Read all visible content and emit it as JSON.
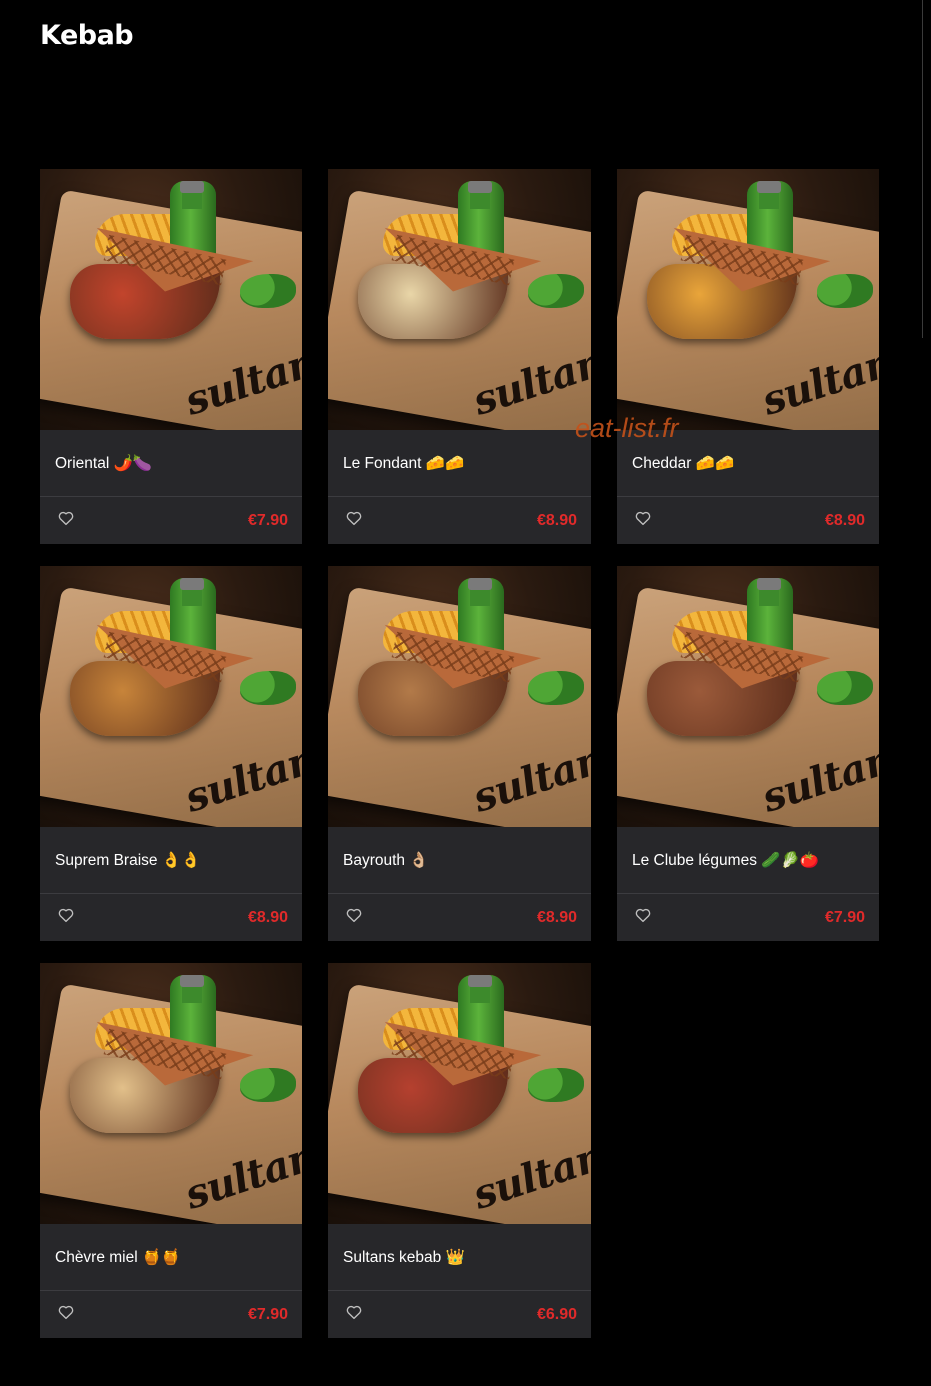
{
  "page": {
    "title": "Kebab"
  },
  "watermark": "eat-list.fr",
  "colors": {
    "background": "#000000",
    "card": "#27272a",
    "price": "#e12a2a"
  },
  "card_icon": "heart-icon",
  "products": [
    {
      "name": "Oriental 🌶️🍆",
      "price": "€7.90",
      "filling": "#c2442c"
    },
    {
      "name": "Le Fondant 🧀🧀",
      "price": "€8.90",
      "filling": "#e9d6a8"
    },
    {
      "name": "Cheddar 🧀🧀",
      "price": "€8.90",
      "filling": "#e9a53a"
    },
    {
      "name": "Suprem Braise 👌👌",
      "price": "€8.90",
      "filling": "#c7843a"
    },
    {
      "name": "Bayrouth 👌🏼",
      "price": "€8.90",
      "filling": "#b27a49"
    },
    {
      "name": "Le Clube légumes 🥒🥬🍅",
      "price": "€7.90",
      "filling": "#9b5a3a"
    },
    {
      "name": "Chèvre miel 🍯🍯",
      "price": "€7.90",
      "filling": "#e2c08a"
    },
    {
      "name": "Sultans kebab 👑",
      "price": "€6.90",
      "filling": "#b5402f"
    }
  ]
}
